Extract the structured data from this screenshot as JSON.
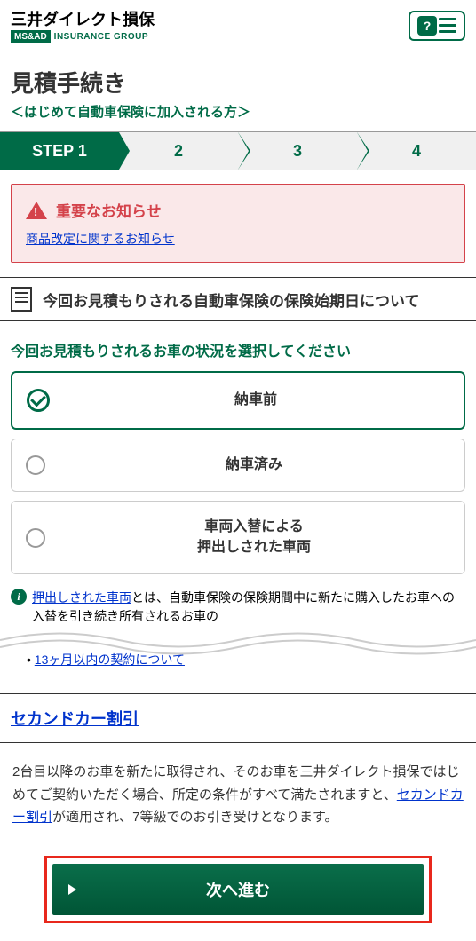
{
  "header": {
    "company_name": "三井ダイレクト損保",
    "msad_badge": "MS&AD",
    "group_text": "INSURANCE GROUP",
    "help_icon": "?"
  },
  "title_section": {
    "title": "見積手続き",
    "subtitle": "＜はじめて自動車保険に加入される方＞"
  },
  "progress": {
    "step1": "STEP 1",
    "step2": "2",
    "step3": "3",
    "step4": "4"
  },
  "notice": {
    "title": "重要なお知らせ",
    "link": "商品改定に関するお知らせ"
  },
  "section": {
    "title": "今回お見積もりされる自動車保険の保険始期日について"
  },
  "question": "今回お見積もりされるお車の状況を選択してください",
  "options": {
    "opt1": "納車前",
    "opt2": "納車済み",
    "opt3_line1": "車両入替による",
    "opt3_line2": "押出しされた車両"
  },
  "info": {
    "link_text": "押出しされた車両",
    "prefix": "とは、自動車保険の保険期間中に新たに購入したお車への入替を引き続き所有されるお車の"
  },
  "sub_link": "13ヶ月以内の契約について",
  "second_car": {
    "title": "セカンドカー割引"
  },
  "description": {
    "text_before": "2台目以降のお車を新たに取得され、そのお車を三井ダイレクト損保ではじめてご契約いただく場合、所定の条件がすべて満たされますと、",
    "link": "セカンドカー割引",
    "text_after": "が適用され、7等級でのお引き受けとなります。"
  },
  "button": {
    "label": "次へ進む"
  }
}
